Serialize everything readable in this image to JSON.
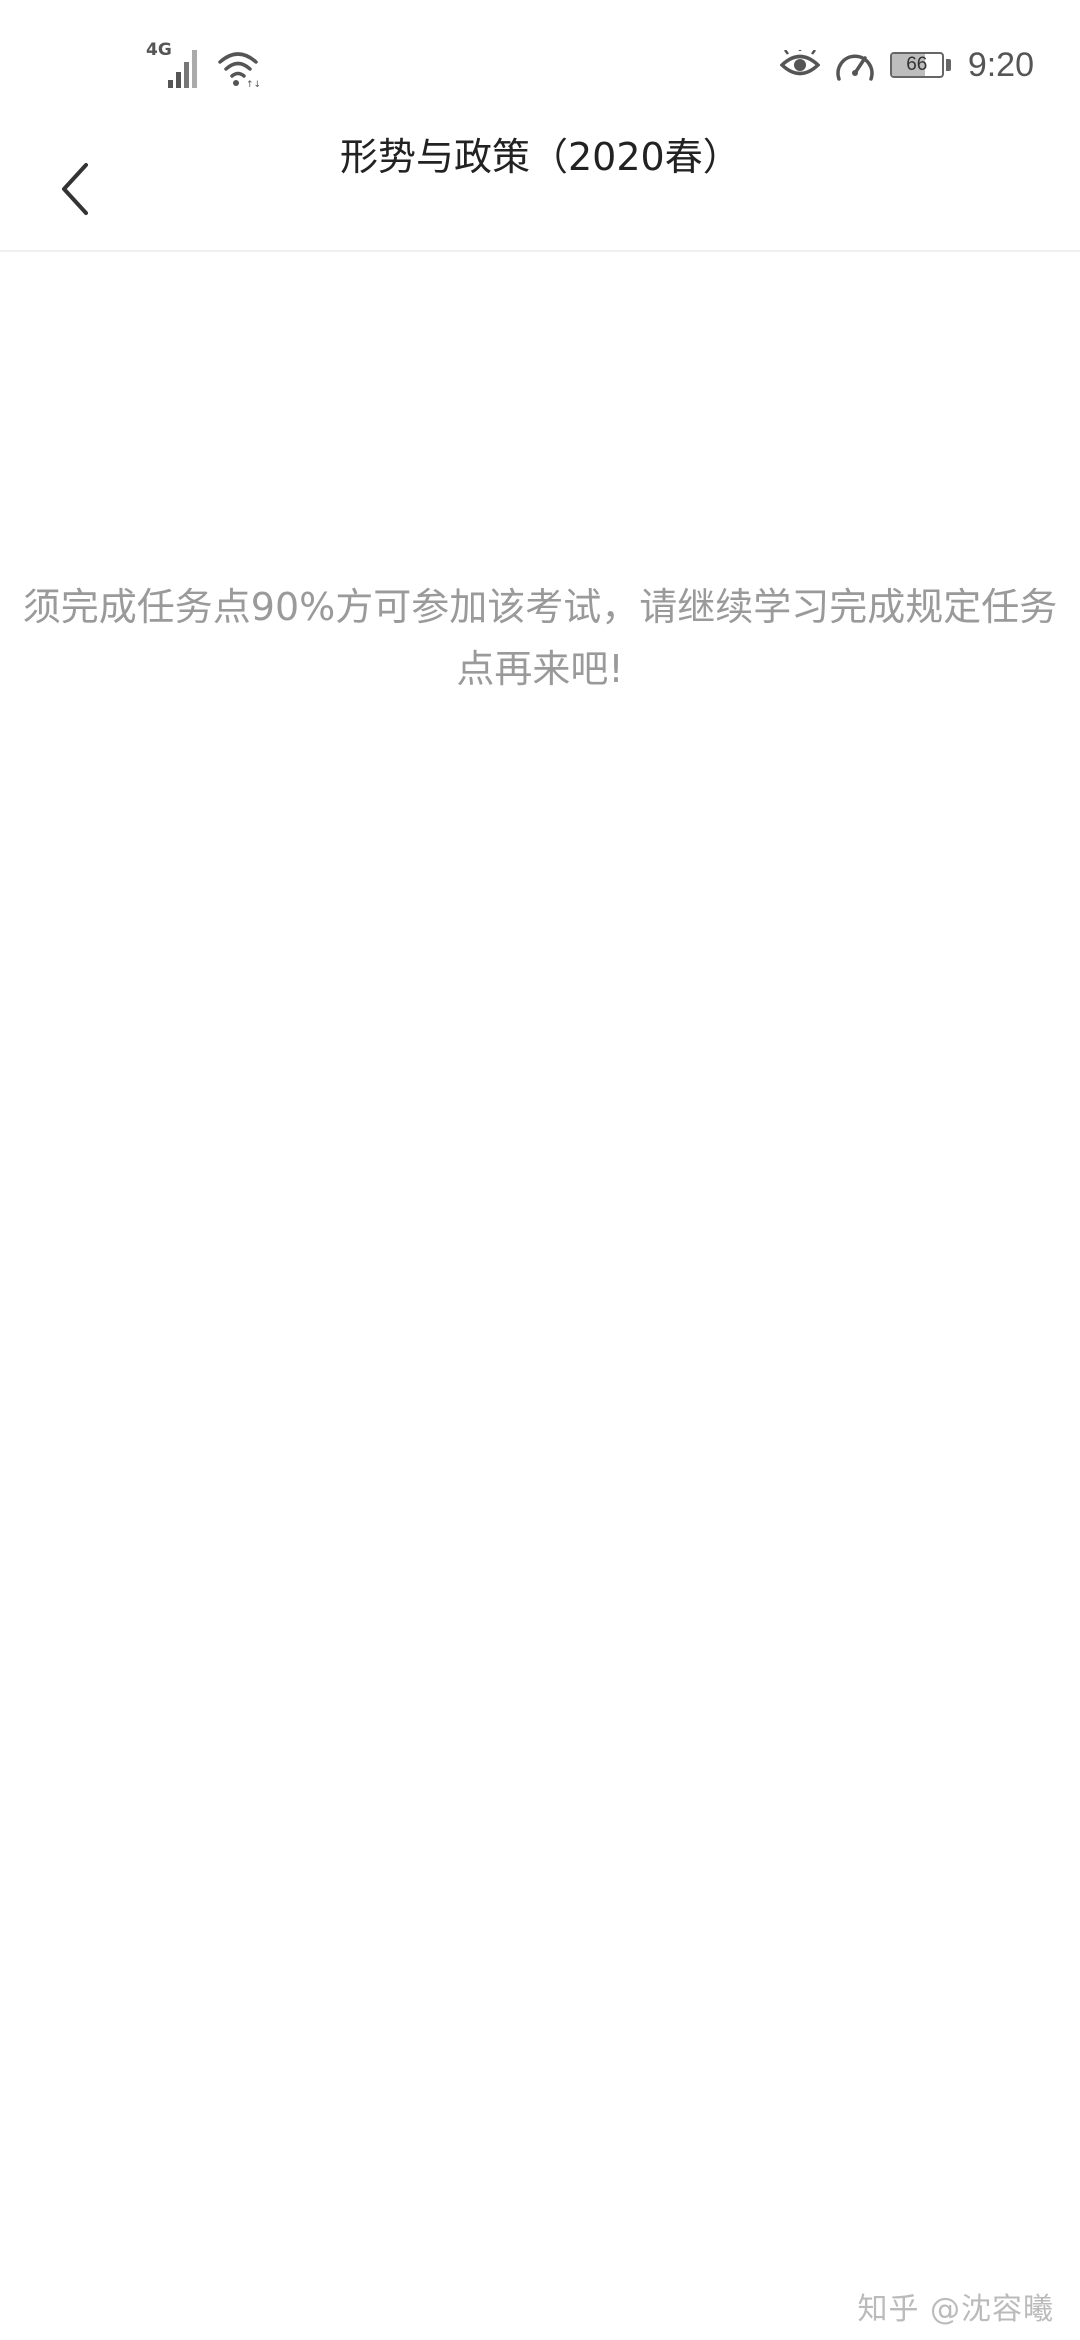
{
  "status_bar": {
    "network": "4G",
    "signal_icon": "signal-bars-icon",
    "wifi_icon": "wifi-icon",
    "eye_icon": "eye-comfort-icon",
    "speed_icon": "speedometer-icon",
    "battery_level": "66",
    "battery_fraction": 0.66,
    "time": "9:20"
  },
  "nav": {
    "back_icon": "chevron-left-icon",
    "title": "形势与政策（2020春）"
  },
  "main": {
    "message": "须完成任务点90%方可参加该考试，请继续学习完成规定任务点再来吧!"
  },
  "watermark": {
    "text": "知乎 @沈容曦"
  },
  "colors": {
    "background": "#ffffff",
    "title_text": "#222222",
    "message_text": "#9a9a9a",
    "divider": "#f0f0f0"
  }
}
